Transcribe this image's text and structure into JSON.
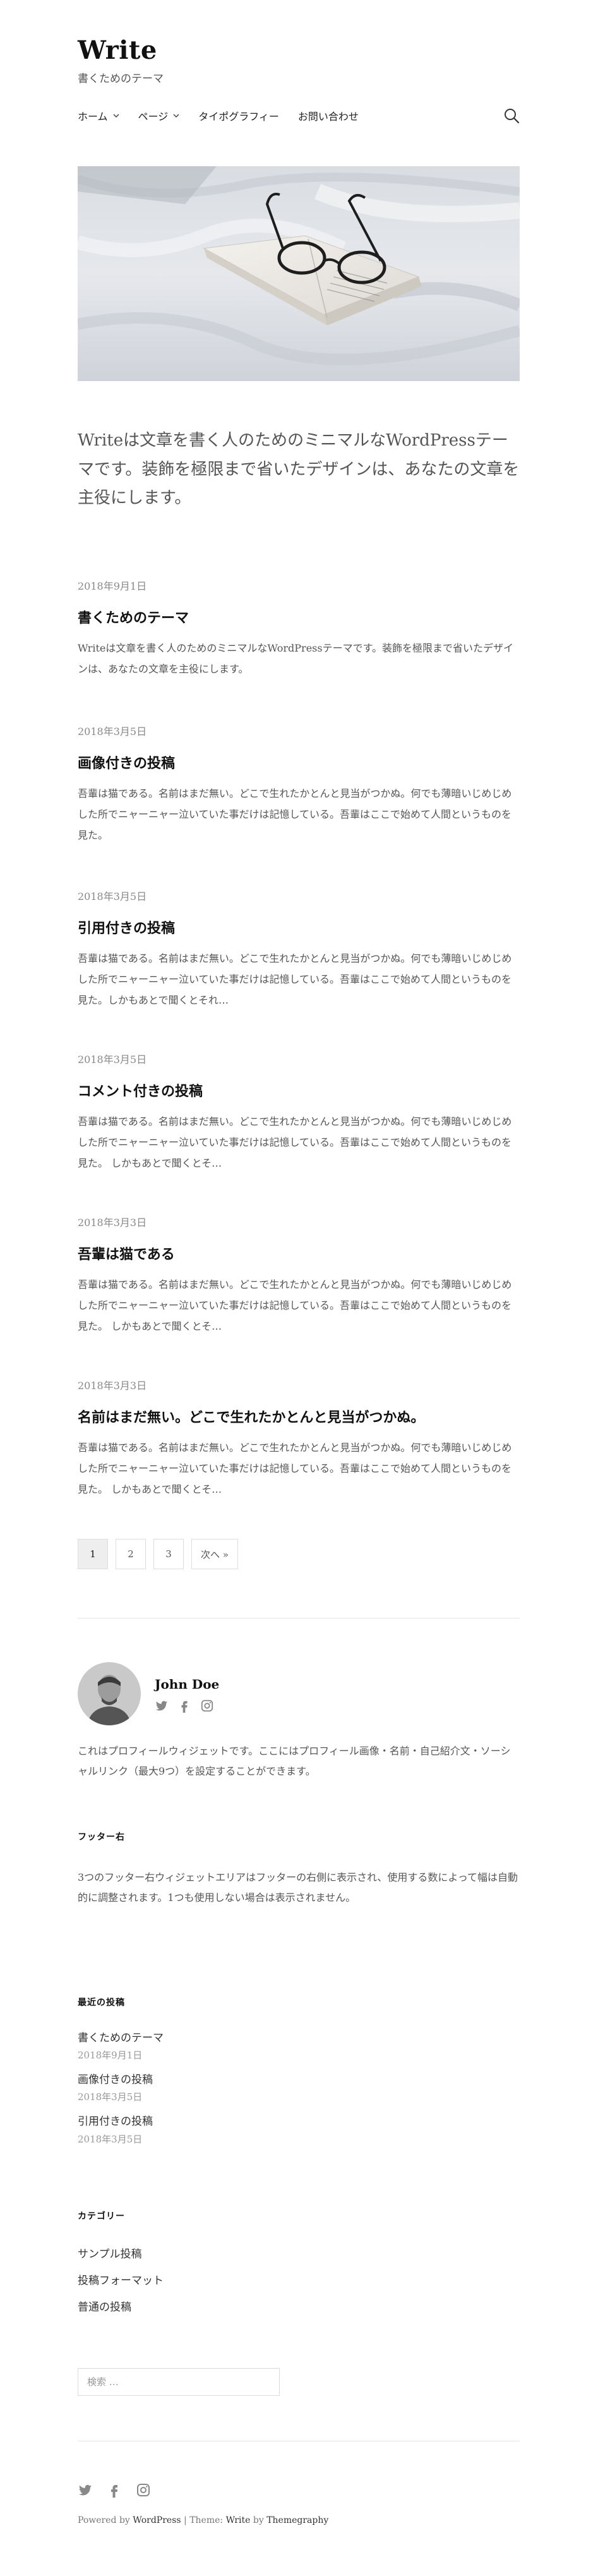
{
  "site": {
    "title": "Write",
    "description": "書くためのテーマ"
  },
  "nav": {
    "items": [
      {
        "label": "ホーム"
      },
      {
        "label": "ページ"
      },
      {
        "label": "タイポグラフィー"
      },
      {
        "label": "お問い合わせ"
      }
    ],
    "search_icon": "search-icon"
  },
  "intro": "Writeは文章を書く人のためのミニマルなWordPressテーマです。装飾を極限まで省いたデザインは、あなたの文章を主役にします。",
  "posts": [
    {
      "date": "2018年9月1日",
      "title": "書くためのテーマ",
      "excerpt": "Writeは文章を書く人のためのミニマルなWordPressテーマです。装飾を極限まで省いたデザインは、あなたの文章を主役にします。"
    },
    {
      "date": "2018年3月5日",
      "title": "画像付きの投稿",
      "excerpt": "吾輩は猫である。名前はまだ無い。どこで生れたかとんと見当がつかぬ。何でも薄暗いじめじめした所でニャーニャー泣いていた事だけは記憶している。吾輩はここで始めて人間というものを見た。"
    },
    {
      "date": "2018年3月5日",
      "title": "引用付きの投稿",
      "excerpt": "吾輩は猫である。名前はまだ無い。どこで生れたかとんと見当がつかぬ。何でも薄暗いじめじめした所でニャーニャー泣いていた事だけは記憶している。吾輩はここで始めて人間というものを見た。しかもあとで聞くとそれ…"
    },
    {
      "date": "2018年3月5日",
      "title": "コメント付きの投稿",
      "excerpt": "吾輩は猫である。名前はまだ無い。どこで生れたかとんと見当がつかぬ。何でも薄暗いじめじめした所でニャーニャー泣いていた事だけは記憶している。吾輩はここで始めて人間というものを見た。 しかもあとで聞くとそ…"
    },
    {
      "date": "2018年3月3日",
      "title": "吾輩は猫である",
      "excerpt": "吾輩は猫である。名前はまだ無い。どこで生れたかとんと見当がつかぬ。何でも薄暗いじめじめした所でニャーニャー泣いていた事だけは記憶している。吾輩はここで始めて人間というものを見た。 しかもあとで聞くとそ…"
    },
    {
      "date": "2018年3月3日",
      "title": "名前はまだ無い。どこで生れたかとんと見当がつかぬ。",
      "excerpt": "吾輩は猫である。名前はまだ無い。どこで生れたかとんと見当がつかぬ。何でも薄暗いじめじめした所でニャーニャー泣いていた事だけは記憶している。吾輩はここで始めて人間というものを見た。 しかもあとで聞くとそ…"
    }
  ],
  "pagination": {
    "pages": [
      "1",
      "2",
      "3"
    ],
    "current": "1",
    "next_label": "次へ »"
  },
  "profile": {
    "name": "John Doe",
    "icons": [
      "twitter-icon",
      "facebook-icon",
      "instagram-icon"
    ],
    "text": "これはプロフィールウィジェットです。ここにはプロフィール画像・名前・自己紹介文・ソーシャルリンク（最大9つ）を設定することができます。"
  },
  "footer_right": {
    "title": "フッター右",
    "text": "3つのフッター右ウィジェットエリアはフッターの右側に表示され、使用する数によって幅は自動的に調整されます。1つも使用しない場合は表示されません。"
  },
  "recent_posts": {
    "title": "最近の投稿",
    "items": [
      {
        "label": "書くためのテーマ",
        "date": "2018年9月1日"
      },
      {
        "label": "画像付きの投稿",
        "date": "2018年3月5日"
      },
      {
        "label": "引用付きの投稿",
        "date": "2018年3月5日"
      }
    ]
  },
  "categories": {
    "title": "カテゴリー",
    "items": [
      "サンプル投稿",
      "投稿フォーマット",
      "普通の投稿"
    ]
  },
  "search": {
    "placeholder": "検索 …"
  },
  "footer": {
    "icons": [
      "twitter-icon",
      "facebook-icon",
      "instagram-icon"
    ],
    "powered_prefix": "Powered by ",
    "powered_link": "WordPress",
    "separator": " | ",
    "theme_prefix": "Theme: ",
    "theme_link": "Write",
    "by_text": " by ",
    "author_link": "Themegraphy"
  }
}
